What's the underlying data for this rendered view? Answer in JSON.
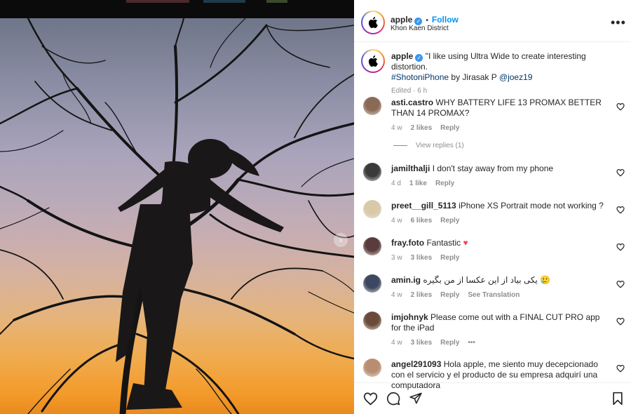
{
  "post": {
    "username": "apple",
    "follow_label": "Follow",
    "separator": "•",
    "location": "Khon Kaen District",
    "more_label": "•••"
  },
  "caption": {
    "username": "apple",
    "text": "\"I like using Ultra Wide to create interesting distortion.",
    "hashtag": "#ShotoniPhone",
    "by_text": " by Jirasak P ",
    "mention": "@joez19",
    "meta": "Edited · 6 h"
  },
  "comments": [
    {
      "username": "asti.castro",
      "text": "WHY BATTERY LIFE 13 PROMAX BETTER THAN 14 PROMAX?",
      "time": "4 w",
      "likes": "2 likes",
      "reply": "Reply",
      "extra": "",
      "view_replies": "View replies (1)",
      "avatar_color": "#8a6a55"
    },
    {
      "username": "jamilthalji",
      "text": "I don't stay away from my phone",
      "time": "4 d",
      "likes": "1 like",
      "reply": "Reply",
      "extra": "",
      "view_replies": "",
      "avatar_color": "#3a3a3a"
    },
    {
      "username": "preet__gill_5113",
      "text": "iPhone XS Portrait mode not working ?",
      "time": "4 w",
      "likes": "6 likes",
      "reply": "Reply",
      "extra": "",
      "view_replies": "",
      "avatar_color": "#d8c9a8"
    },
    {
      "username": "fray.foto",
      "text": "Fantastic ",
      "time": "3 w",
      "likes": "3 likes",
      "reply": "Reply",
      "extra": "",
      "view_replies": "",
      "avatar_color": "#5a3c3c"
    },
    {
      "username": "amin.ig",
      "text": "یکی بیاد از این عکسا از من بگیره 🥲",
      "time": "4 w",
      "likes": "2 likes",
      "reply": "Reply",
      "extra": "See Translation",
      "view_replies": "",
      "avatar_color": "#3d4860"
    },
    {
      "username": "imjohnyk",
      "text": "Please come out with a FINAL CUT PRO app for the iPad",
      "time": "4 w",
      "likes": "3 likes",
      "reply": "Reply",
      "extra": "•••",
      "view_replies": "",
      "avatar_color": "#6a4a3a"
    },
    {
      "username": "angel291093",
      "text": "Hola apple, me siento muy decepcionado con el servicio y el producto de su empresa adquirí una computadora",
      "time": "",
      "likes": "",
      "reply": "",
      "extra": "",
      "view_replies": "",
      "avatar_color": "#b88d70"
    }
  ],
  "colors": {
    "follow": "#0095f6",
    "link": "#00376b",
    "meta": "#8e8e8e",
    "heart_red": "#ed4956"
  },
  "icons": [
    "heart-icon",
    "comment-icon",
    "share-icon",
    "bookmark-icon",
    "apple-logo-icon",
    "verified-icon",
    "chevron-right-icon"
  ]
}
